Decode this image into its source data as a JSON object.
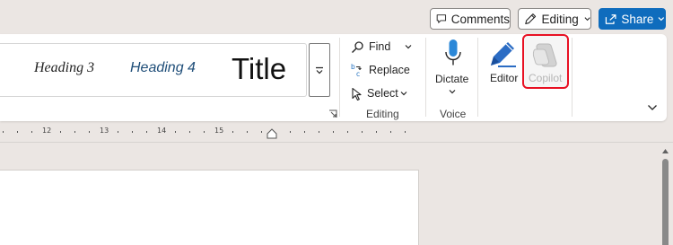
{
  "topbar": {
    "comments_label": "Comments",
    "editing_label": "Editing",
    "share_label": "Share"
  },
  "styles": {
    "heading3": "Heading 3",
    "heading4": "Heading 4",
    "title": "Title"
  },
  "editing": {
    "find": "Find",
    "replace": "Replace",
    "select": "Select",
    "group_label": "Editing"
  },
  "voice": {
    "dictate": "Dictate",
    "group_label": "Voice"
  },
  "editor_label": "Editor",
  "copilot_label": "Copilot",
  "ruler": {
    "numbers": [
      "12",
      "13",
      "14",
      "15"
    ]
  },
  "colors": {
    "share_blue": "#0f6cbd",
    "copilot_highlight": "#e81123",
    "heading4_blue": "#1f4e79"
  },
  "icons": [
    "comment-icon",
    "pen-icon",
    "share-icon",
    "search-icon",
    "replace-icon",
    "cursor-icon",
    "microphone-icon",
    "editor-pen-icon",
    "copilot-icon",
    "dialog-launcher-icon",
    "chevron-down-icon"
  ]
}
